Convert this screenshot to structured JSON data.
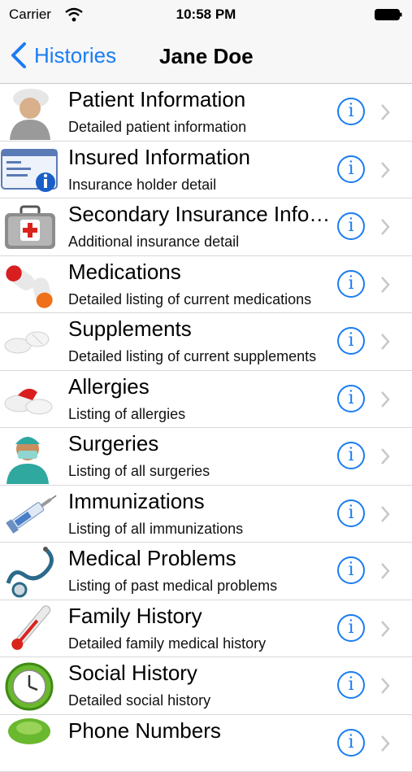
{
  "status_bar": {
    "carrier": "Carrier",
    "time": "10:58 PM"
  },
  "nav": {
    "back_label": "Histories",
    "title": "Jane Doe"
  },
  "colors": {
    "accent": "#1a7cf4"
  },
  "rows": [
    {
      "title": "Patient Information",
      "subtitle": "Detailed patient information",
      "icon": "nurse-icon",
      "info": "i"
    },
    {
      "title": "Insured Information",
      "subtitle": "Insurance holder detail",
      "icon": "id-card-icon",
      "info": "i"
    },
    {
      "title": "Secondary Insurance Info…",
      "subtitle": "Additional insurance detail",
      "icon": "medical-case-icon",
      "info": "i"
    },
    {
      "title": "Medications",
      "subtitle": "Detailed listing of current medications",
      "icon": "pills-icon",
      "info": "i"
    },
    {
      "title": "Supplements",
      "subtitle": "Detailed listing of current supplements",
      "icon": "tablets-icon",
      "info": "i"
    },
    {
      "title": "Allergies",
      "subtitle": "Listing of allergies",
      "icon": "allergy-pills-icon",
      "info": "i"
    },
    {
      "title": "Surgeries",
      "subtitle": "Listing of all surgeries",
      "icon": "surgeon-icon",
      "info": "i"
    },
    {
      "title": "Immunizations",
      "subtitle": "Listing of all immunizations",
      "icon": "syringe-icon",
      "info": "i"
    },
    {
      "title": "Medical Problems",
      "subtitle": "Listing of past medical problems",
      "icon": "stethoscope-icon",
      "info": "i"
    },
    {
      "title": "Family History",
      "subtitle": "Detailed family medical history",
      "icon": "thermometer-icon",
      "info": "i"
    },
    {
      "title": "Social History",
      "subtitle": "Detailed social history",
      "icon": "clock-icon",
      "info": "i"
    },
    {
      "title": "Phone Numbers",
      "subtitle": "",
      "icon": "phone-icon",
      "info": "i"
    }
  ]
}
